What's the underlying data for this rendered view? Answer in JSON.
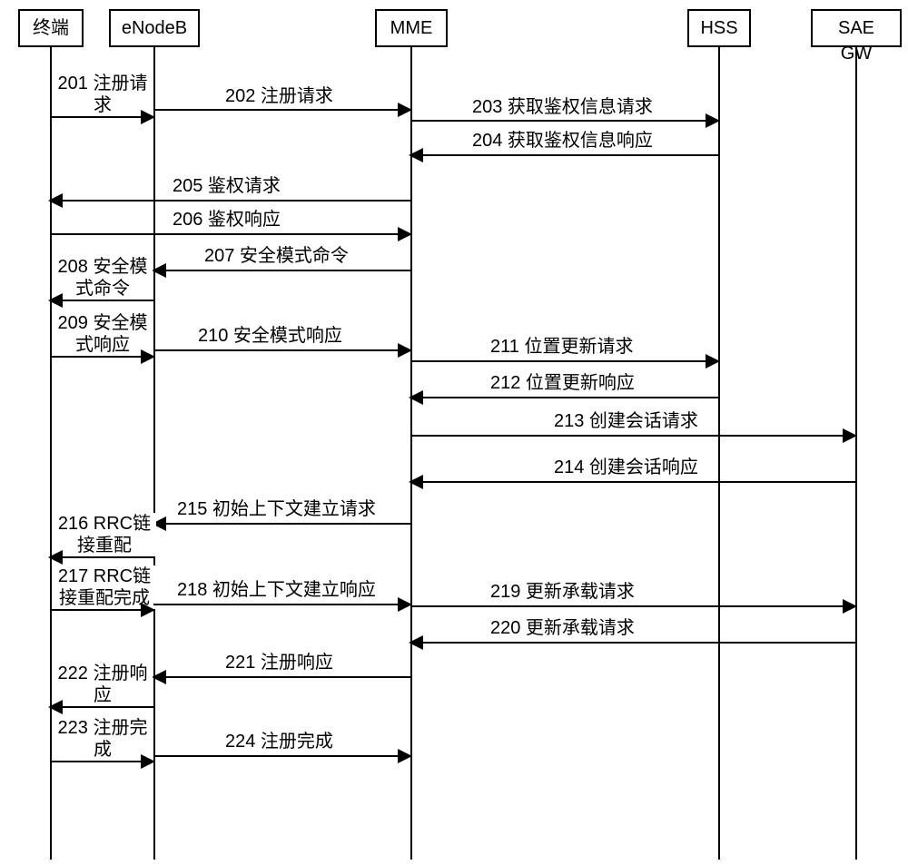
{
  "actors": {
    "terminal": "终端",
    "enodeb": "eNodeB",
    "mme": "MME",
    "hss": "HSS",
    "saegw": "SAE GW"
  },
  "messages": {
    "m201": "201 注册请求",
    "m202": "202 注册请求",
    "m203": "203 获取鉴权信息请求",
    "m204": "204 获取鉴权信息响应",
    "m205": "205 鉴权请求",
    "m206": "206 鉴权响应",
    "m207": "207 安全模式命令",
    "m208": "208 安全模式命令",
    "m209": "209 安全模式响应",
    "m210": "210 安全模式响应",
    "m211": "211 位置更新请求",
    "m212": "212 位置更新响应",
    "m213": "213 创建会话请求",
    "m214": "214 创建会话响应",
    "m215": "215 初始上下文建立请求",
    "m216": "216 RRC链接重配",
    "m217": "217 RRC链接重配完成",
    "m218": "218 初始上下文建立响应",
    "m219": "219 更新承载请求",
    "m220": "220 更新承载请求",
    "m221": "221 注册响应",
    "m222": "222 注册响应",
    "m223": "223 注册完成",
    "m224": "224 注册完成"
  }
}
